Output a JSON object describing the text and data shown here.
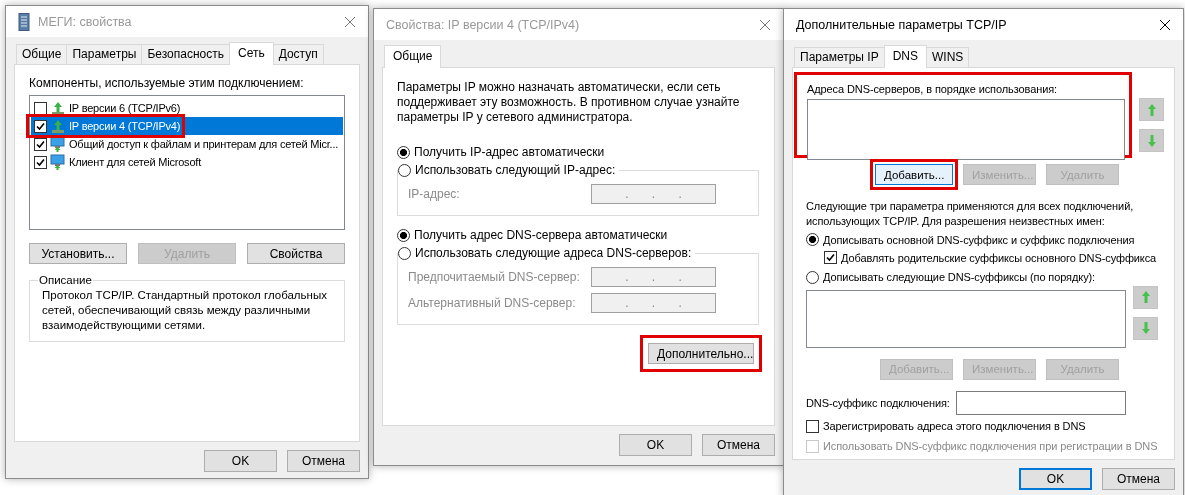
{
  "connection_dialog": {
    "title": "МЕГИ: свойства",
    "active": false,
    "tabs": [
      {
        "label": "Общие",
        "selected": false
      },
      {
        "label": "Параметры",
        "selected": false
      },
      {
        "label": "Безопасность",
        "selected": false
      },
      {
        "label": "Сеть",
        "selected": true
      },
      {
        "label": "Доступ",
        "selected": false
      }
    ],
    "components_label": "Компоненты, используемые этим подключением:",
    "components": [
      {
        "label": "IP версии 6 (TCP/IPv6)",
        "kind": "protocol",
        "checked": false,
        "selected": false,
        "highlighted": false
      },
      {
        "label": "IP версии 4 (TCP/IPv4)",
        "kind": "protocol",
        "checked": true,
        "selected": true,
        "highlighted": true
      },
      {
        "label": "Общий доступ к файлам и принтерам для сетей Micr...",
        "kind": "service",
        "checked": true,
        "selected": false,
        "highlighted": false
      },
      {
        "label": "Клиент для сетей Microsoft",
        "kind": "service",
        "checked": true,
        "selected": false,
        "highlighted": false
      }
    ],
    "buttons": [
      {
        "label": "Установить...",
        "disabled": false
      },
      {
        "label": "Удалить",
        "disabled": true
      },
      {
        "label": "Свойства",
        "disabled": false
      }
    ],
    "description": {
      "legend": "Описание",
      "lines": [
        "Протокол TCP/IP. Стандартный протокол глобальных",
        "сетей, обеспечивающий связь между различными",
        "взаимодействующими сетями."
      ]
    },
    "footer": [
      {
        "label": "OK",
        "default": false
      },
      {
        "label": "Отмена",
        "default": false
      }
    ]
  },
  "ipv4_dialog": {
    "title": "Свойства: IP версии 4 (TCP/IPv4)",
    "active": false,
    "tabs": [
      {
        "label": "Общие",
        "selected": true
      }
    ],
    "intro": [
      "Параметры IP можно назначать автоматически, если сеть",
      "поддерживает эту возможность. В противном случае узнайте",
      "параметры IP у сетевого администратора."
    ],
    "ip_section": {
      "options": [
        {
          "label": "Получить IP-адрес автоматически",
          "selected": true
        },
        {
          "label": "Использовать следующий IP-адрес:",
          "selected": false
        }
      ],
      "fields": [
        {
          "label": "IP-адрес:",
          "value": ".       .       .",
          "disabled": true
        }
      ]
    },
    "dns_section": {
      "options": [
        {
          "label": "Получить адрес DNS-сервера автоматически",
          "selected": true
        },
        {
          "label": "Использовать следующие адреса DNS-серверов:",
          "selected": false
        }
      ],
      "fields": [
        {
          "label": "Предпочитаемый DNS-сервер:",
          "value": ".       .       .",
          "disabled": true
        },
        {
          "label": "Альтернативный DNS-сервер:",
          "value": ".       .       .",
          "disabled": true
        }
      ]
    },
    "advanced_button": {
      "label": "Дополнительно...",
      "highlighted": true
    },
    "footer": [
      {
        "label": "OK",
        "default": false
      },
      {
        "label": "Отмена",
        "default": false
      }
    ]
  },
  "advanced_dialog": {
    "title": "Дополнительные параметры TCP/IP",
    "active": true,
    "tabs": [
      {
        "label": "Параметры IP",
        "selected": false
      },
      {
        "label": "DNS",
        "selected": true
      },
      {
        "label": "WINS",
        "selected": false
      }
    ],
    "dns_servers": {
      "label": "Адреса DNS-серверов, в порядке использования:",
      "highlighted": true
    },
    "server_buttons": [
      {
        "label": "Добавить...",
        "disabled": false,
        "highlighted": true
      },
      {
        "label": "Изменить...",
        "disabled": true,
        "highlighted": false
      },
      {
        "label": "Удалить",
        "disabled": true,
        "highlighted": false
      }
    ],
    "note": [
      "Следующие три параметра применяются для всех подключений,",
      "использующих TCP/IP. Для разрешения неизвестных имен:"
    ],
    "suffix_options": [
      {
        "label": "Дописывать основной DNS-суффикс и суффикс подключения",
        "selected": true,
        "children": [
          {
            "label": "Добавлять родительские суффиксы основного DNS-суффикса",
            "checked": true
          }
        ]
      },
      {
        "label": "Дописывать следующие DNS-суффиксы (по порядку):",
        "selected": false
      }
    ],
    "suffix_buttons": [
      {
        "label": "Добавить...",
        "disabled": true
      },
      {
        "label": "Изменить...",
        "disabled": true
      },
      {
        "label": "Удалить",
        "disabled": true
      }
    ],
    "connection_suffix": {
      "label": "DNS-суффикс подключения:"
    },
    "checkboxes": [
      {
        "label": "Зарегистрировать адреса этого подключения в DNS",
        "checked": false,
        "disabled": false
      },
      {
        "label": "Использовать DNS-суффикс подключения при регистрации в DNS",
        "checked": false,
        "disabled": true
      }
    ],
    "footer": [
      {
        "label": "OK",
        "default": true
      },
      {
        "label": "Отмена",
        "default": false
      }
    ]
  }
}
